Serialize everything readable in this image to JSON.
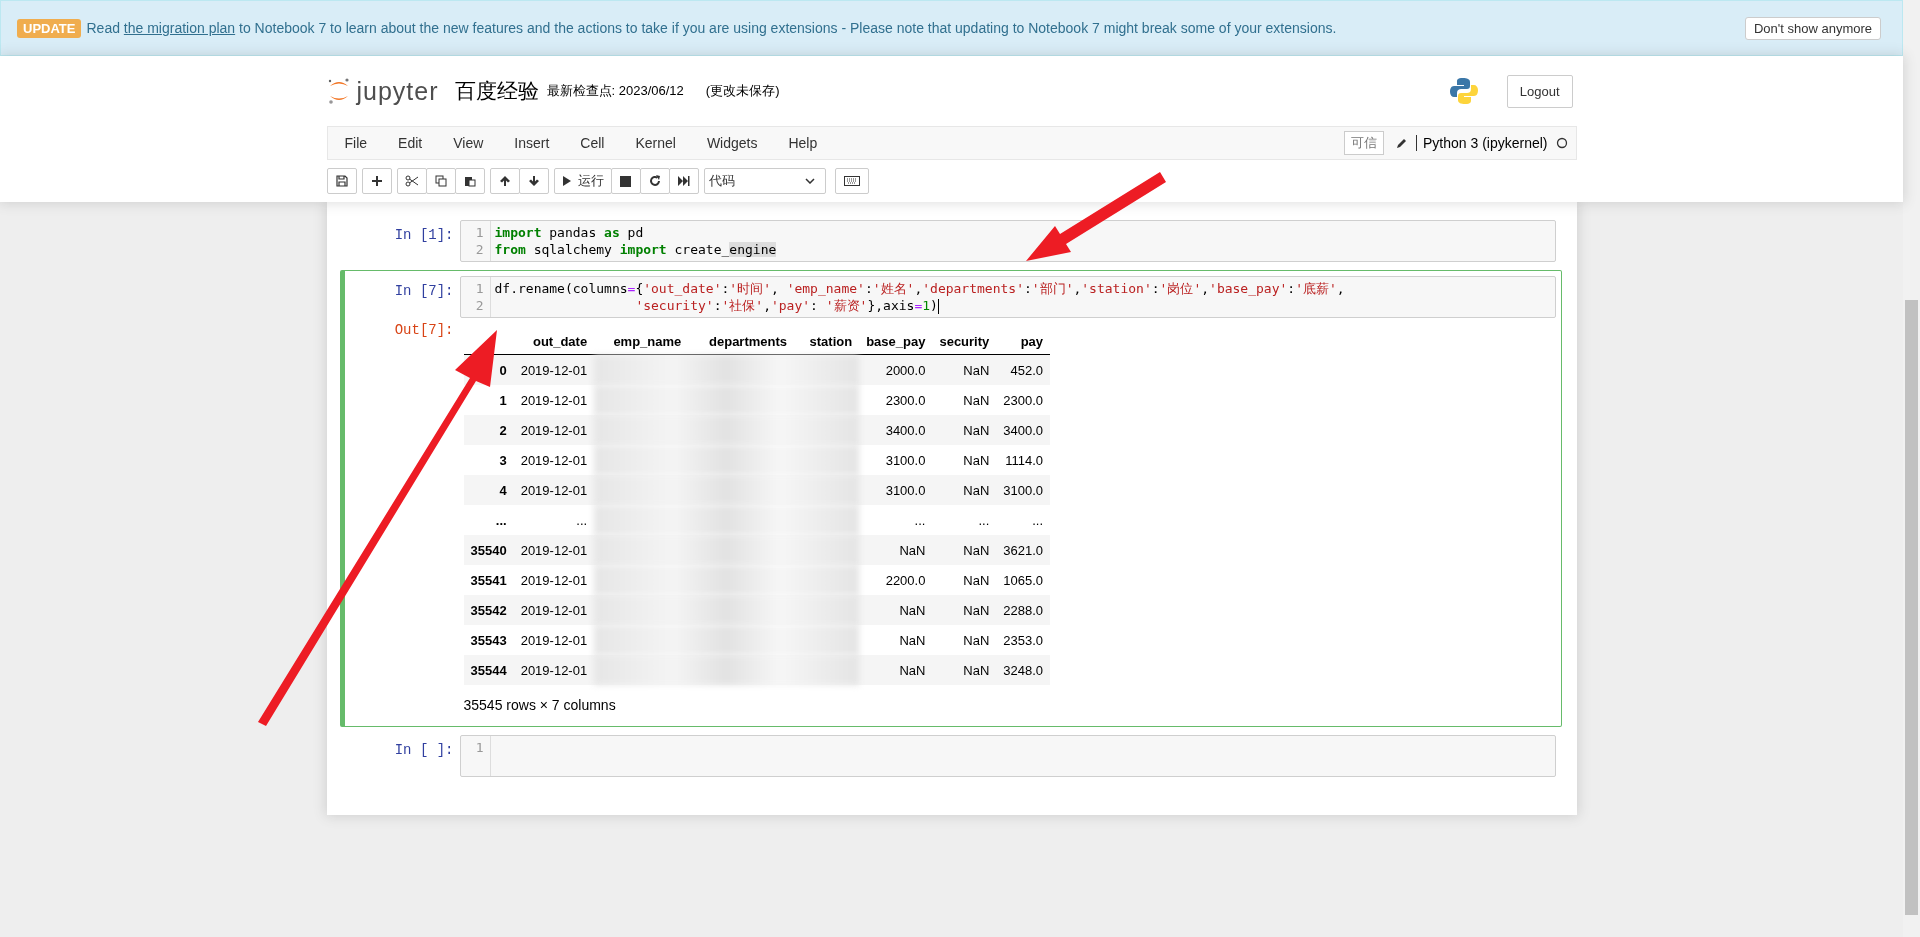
{
  "banner": {
    "badge": "UPDATE",
    "text_before": "Read",
    "link": "the migration plan",
    "text_after": "to Notebook 7 to learn about the new features and the actions to take if you are using extensions - Please note that updating to Notebook 7 might break some of your extensions.",
    "dismiss": "Don't show anymore"
  },
  "header": {
    "logo_text": "jupyter",
    "notebook_name": "百度经验",
    "checkpoint": "最新检查点: 2023/06/12",
    "autosave": "(更改未保存)",
    "logout": "Logout"
  },
  "menu": [
    "File",
    "Edit",
    "View",
    "Insert",
    "Cell",
    "Kernel",
    "Widgets",
    "Help"
  ],
  "trusted": "可信",
  "kernel_name": "Python 3 (ipykernel)",
  "toolbar": {
    "run": "运行",
    "cell_type": "代码"
  },
  "cells": [
    {
      "prompt": "In [1]:",
      "selected": false,
      "lines": [
        {
          "number": "1",
          "tokens": [
            {
              "kind": "kw",
              "text": "import"
            },
            {
              "kind": "plain",
              "text": " pandas "
            },
            {
              "kind": "kw",
              "text": "as"
            },
            {
              "kind": "plain",
              "text": " pd"
            }
          ]
        },
        {
          "number": "2",
          "tokens": [
            {
              "kind": "kw",
              "text": "from"
            },
            {
              "kind": "plain",
              "text": " sqlalchemy "
            },
            {
              "kind": "kw",
              "text": "import"
            },
            {
              "kind": "plain",
              "text": " create_"
            },
            {
              "kind": "hl",
              "text": "engine"
            }
          ]
        }
      ]
    },
    {
      "prompt": "In [7]:",
      "selected": true,
      "lines": [
        {
          "number": "1",
          "tokens": [
            {
              "kind": "plain",
              "text": "df.rename(columns"
            },
            {
              "kind": "op",
              "text": "="
            },
            {
              "kind": "plain",
              "text": "{"
            },
            {
              "kind": "str",
              "text": "'out_date'"
            },
            {
              "kind": "plain",
              "text": ":"
            },
            {
              "kind": "str",
              "text": "'时间'"
            },
            {
              "kind": "plain",
              "text": ", "
            },
            {
              "kind": "str",
              "text": "'emp_name'"
            },
            {
              "kind": "plain",
              "text": ":"
            },
            {
              "kind": "str",
              "text": "'姓名'"
            },
            {
              "kind": "plain",
              "text": ","
            },
            {
              "kind": "str",
              "text": "'departments'"
            },
            {
              "kind": "plain",
              "text": ":"
            },
            {
              "kind": "str",
              "text": "'部门'"
            },
            {
              "kind": "plain",
              "text": ","
            },
            {
              "kind": "str",
              "text": "'station'"
            },
            {
              "kind": "plain",
              "text": ":"
            },
            {
              "kind": "str",
              "text": "'岗位'"
            },
            {
              "kind": "plain",
              "text": ","
            },
            {
              "kind": "str",
              "text": "'base_pay'"
            },
            {
              "kind": "plain",
              "text": ":"
            },
            {
              "kind": "str",
              "text": "'底薪'"
            },
            {
              "kind": "plain",
              "text": ","
            }
          ]
        },
        {
          "number": "2",
          "indented": true,
          "tokens": [
            {
              "kind": "str",
              "text": "'security'"
            },
            {
              "kind": "plain",
              "text": ":"
            },
            {
              "kind": "str",
              "text": "'社保'"
            },
            {
              "kind": "plain",
              "text": ","
            },
            {
              "kind": "str",
              "text": "'pay'"
            },
            {
              "kind": "plain",
              "text": ": "
            },
            {
              "kind": "str",
              "text": "'薪资'"
            },
            {
              "kind": "plain",
              "text": "},axis"
            },
            {
              "kind": "op",
              "text": "="
            },
            {
              "kind": "num",
              "text": "1"
            },
            {
              "kind": "plain",
              "text": ")"
            }
          ]
        }
      ],
      "output": {
        "prompt": "Out[7]:",
        "columns": [
          "out_date",
          "emp_name",
          "departments",
          "station",
          "base_pay",
          "security",
          "pay"
        ],
        "rows": [
          {
            "index": "0",
            "out_date": "2019-12-01",
            "base_pay": "2000.0",
            "security": "NaN",
            "pay": "452.0"
          },
          {
            "index": "1",
            "out_date": "2019-12-01",
            "base_pay": "2300.0",
            "security": "NaN",
            "pay": "2300.0"
          },
          {
            "index": "2",
            "out_date": "2019-12-01",
            "base_pay": "3400.0",
            "security": "NaN",
            "pay": "3400.0"
          },
          {
            "index": "3",
            "out_date": "2019-12-01",
            "base_pay": "3100.0",
            "security": "NaN",
            "pay": "1114.0"
          },
          {
            "index": "4",
            "out_date": "2019-12-01",
            "base_pay": "3100.0",
            "security": "NaN",
            "pay": "3100.0"
          },
          {
            "index": "...",
            "out_date": "...",
            "base_pay": "...",
            "security": "...",
            "pay": "..."
          },
          {
            "index": "35540",
            "out_date": "2019-12-01",
            "base_pay": "NaN",
            "security": "NaN",
            "pay": "3621.0"
          },
          {
            "index": "35541",
            "out_date": "2019-12-01",
            "base_pay": "2200.0",
            "security": "NaN",
            "pay": "1065.0"
          },
          {
            "index": "35542",
            "out_date": "2019-12-01",
            "base_pay": "NaN",
            "security": "NaN",
            "pay": "2288.0"
          },
          {
            "index": "35543",
            "out_date": "2019-12-01",
            "base_pay": "NaN",
            "security": "NaN",
            "pay": "2353.0"
          },
          {
            "index": "35544",
            "out_date": "2019-12-01",
            "base_pay": "NaN",
            "security": "NaN",
            "pay": "3248.0"
          }
        ],
        "shape": "35545 rows × 7 columns"
      }
    },
    {
      "prompt": "In [ ]:",
      "selected": false,
      "lines": [
        {
          "number": "1"
        }
      ]
    }
  ]
}
